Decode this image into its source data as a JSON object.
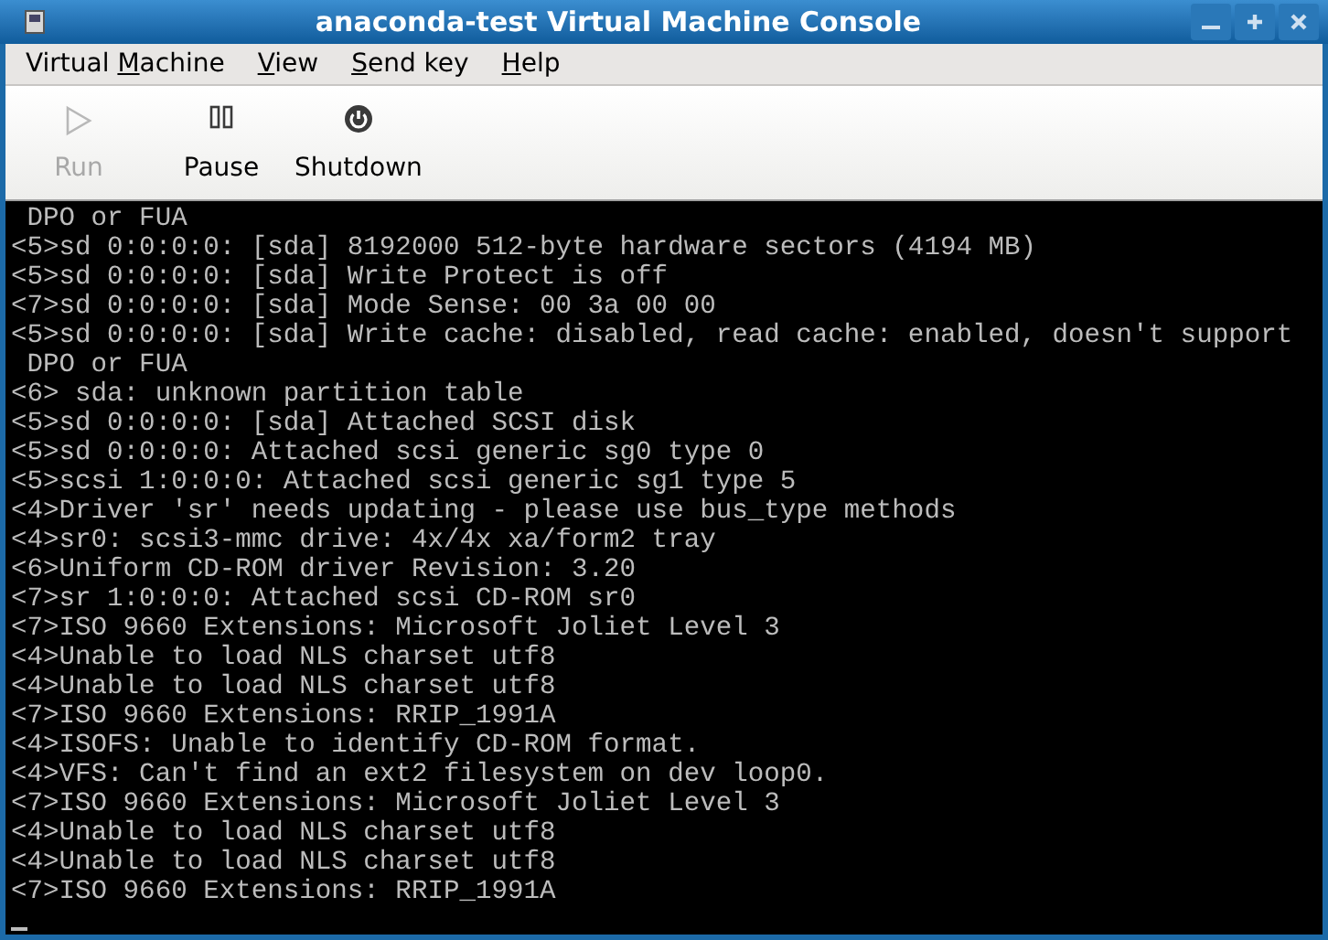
{
  "window": {
    "title": "anaconda-test Virtual Machine Console"
  },
  "menu": [
    {
      "before": "Virtual ",
      "mnemonic": "M",
      "after": "achine"
    },
    {
      "mnemonic": "V",
      "after": "iew"
    },
    {
      "mnemonic": "S",
      "after": "end key"
    },
    {
      "mnemonic": "H",
      "after": "elp"
    }
  ],
  "toolbar": [
    {
      "kind": "run",
      "label": "Run",
      "disabled": true
    },
    {
      "kind": "pause",
      "label": "Pause",
      "disabled": false
    },
    {
      "kind": "shutdown",
      "label": "Shutdown",
      "disabled": false
    }
  ],
  "console": {
    "lines": [
      " DPO or FUA",
      "<5>sd 0:0:0:0: [sda] 8192000 512-byte hardware sectors (4194 MB)",
      "<5>sd 0:0:0:0: [sda] Write Protect is off",
      "<7>sd 0:0:0:0: [sda] Mode Sense: 00 3a 00 00",
      "<5>sd 0:0:0:0: [sda] Write cache: disabled, read cache: enabled, doesn't support",
      " DPO or FUA",
      "<6> sda: unknown partition table",
      "<5>sd 0:0:0:0: [sda] Attached SCSI disk",
      "<5>sd 0:0:0:0: Attached scsi generic sg0 type 0",
      "<5>scsi 1:0:0:0: Attached scsi generic sg1 type 5",
      "<4>Driver 'sr' needs updating - please use bus_type methods",
      "<4>sr0: scsi3-mmc drive: 4x/4x xa/form2 tray",
      "<6>Uniform CD-ROM driver Revision: 3.20",
      "<7>sr 1:0:0:0: Attached scsi CD-ROM sr0",
      "<7>ISO 9660 Extensions: Microsoft Joliet Level 3",
      "<4>Unable to load NLS charset utf8",
      "<4>Unable to load NLS charset utf8",
      "<7>ISO 9660 Extensions: RRIP_1991A",
      "<4>ISOFS: Unable to identify CD-ROM format.",
      "<4>VFS: Can't find an ext2 filesystem on dev loop0.",
      "<7>ISO 9660 Extensions: Microsoft Joliet Level 3",
      "<4>Unable to load NLS charset utf8",
      "<4>Unable to load NLS charset utf8",
      "<7>ISO 9660 Extensions: RRIP_1991A"
    ]
  }
}
